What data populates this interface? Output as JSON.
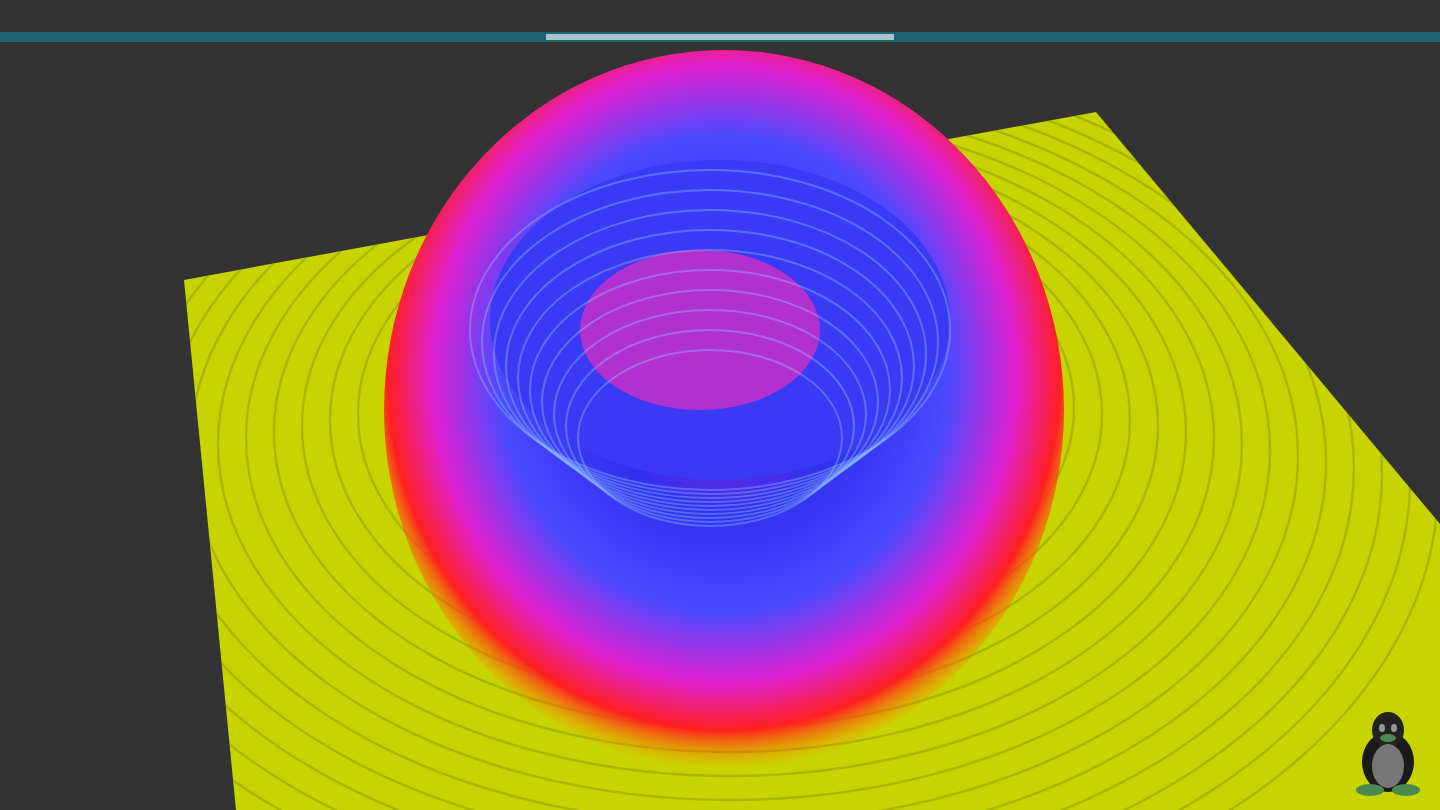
{
  "scene": {
    "kind": "surface"
  }
}
